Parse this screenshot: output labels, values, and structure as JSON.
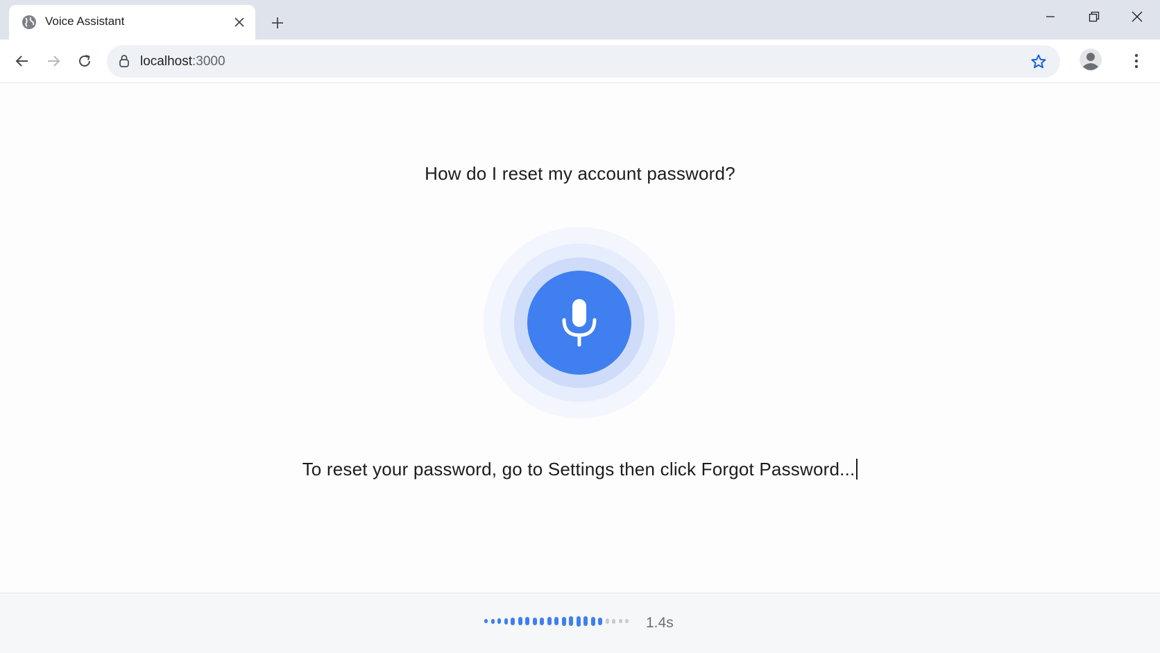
{
  "browser": {
    "tab": {
      "title": "Voice Assistant"
    },
    "address": {
      "host": "localhost",
      "port": ":3000"
    }
  },
  "conversation": {
    "question": "How do I reset my account password?",
    "response": "To reset your password, go to Settings then click Forgot Password..."
  },
  "playback": {
    "elapsed": "1.4s",
    "progress": 0.8,
    "segments": 21
  },
  "colors": {
    "accent": "#3f7ff0",
    "accent_light": "#cfdcf9",
    "inactive": "#c7cbd1",
    "tab_strip": "#dfe3eb",
    "omnibox": "#eef1f6",
    "star": "#1a5fd6"
  },
  "icons": {
    "favicon": "globe-icon",
    "tab_close": "close-icon",
    "new_tab": "plus-icon",
    "minimize": "minimize-icon",
    "maximize": "restore-icon",
    "window_close": "close-icon",
    "back": "arrow-left-icon",
    "forward": "arrow-right-icon",
    "reload": "reload-icon",
    "site_info": "lock-icon",
    "bookmark": "star-icon",
    "profile": "avatar-icon",
    "menu": "kebab-menu-icon",
    "mic": "microphone-icon"
  }
}
